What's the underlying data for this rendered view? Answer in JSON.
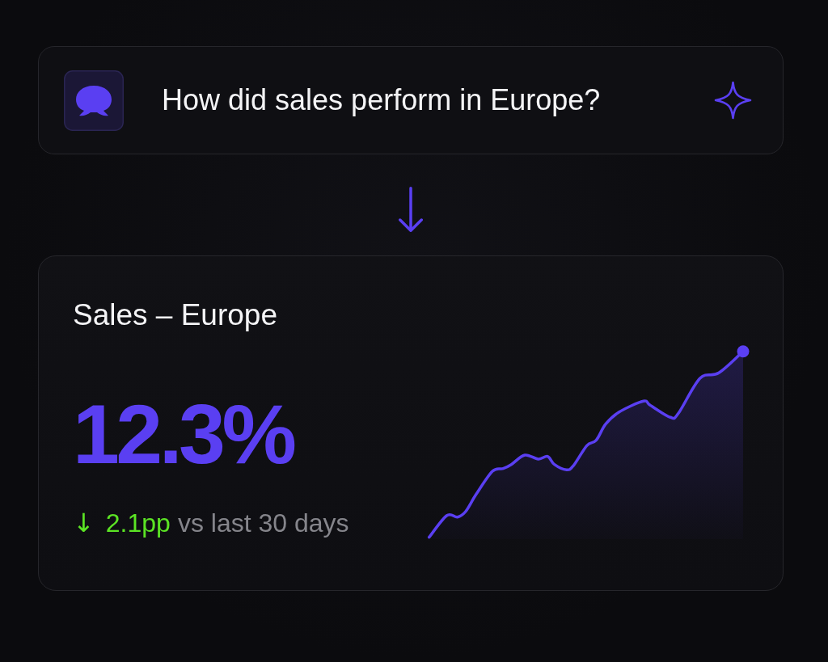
{
  "prompt": {
    "text": "How did sales perform in Europe?"
  },
  "metric_card": {
    "title": "Sales – Europe",
    "value": "12.3%",
    "change": {
      "arrow": "↓",
      "amount": "2.1pp",
      "comparison": "vs last 30 days"
    }
  }
}
